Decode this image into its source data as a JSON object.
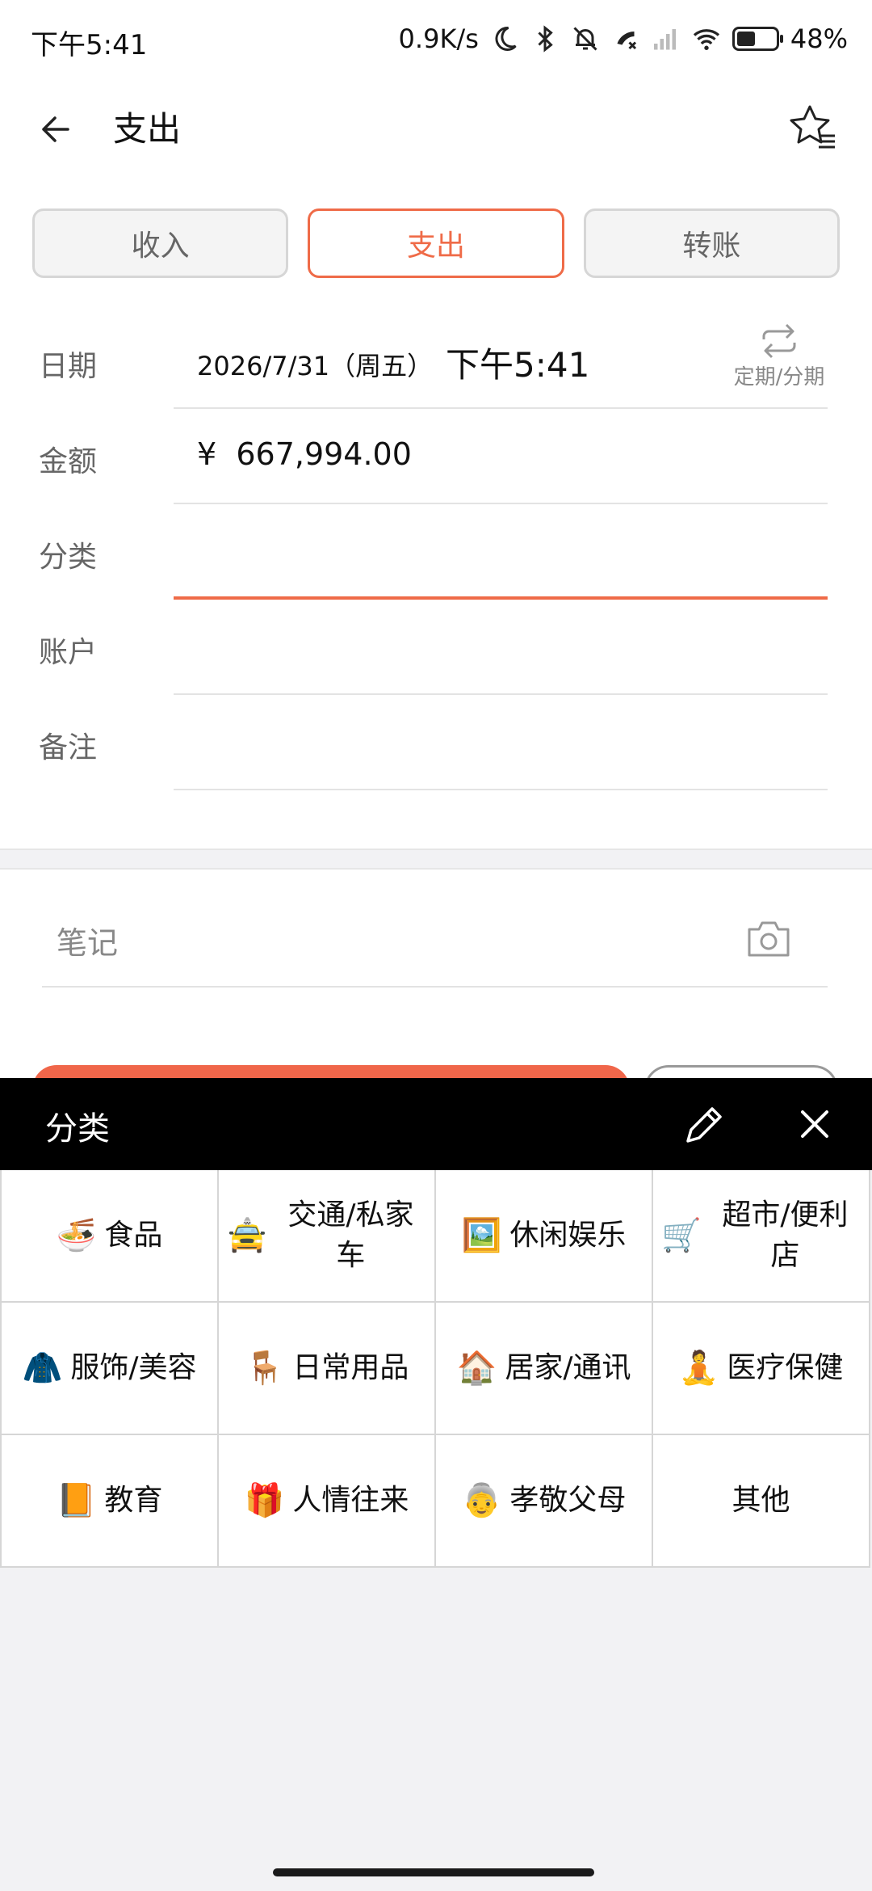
{
  "status_bar": {
    "time": "下午5:41",
    "network_speed": "0.9K/s",
    "battery_percent": "48%",
    "battery_level": 0.48
  },
  "header": {
    "title": "支出",
    "back_icon": "arrow-left-icon",
    "favorite_icon": "star-list-icon"
  },
  "tabs": [
    {
      "label": "收入",
      "active": false
    },
    {
      "label": "支出",
      "active": true
    },
    {
      "label": "转账",
      "active": false
    }
  ],
  "form": {
    "date_label": "日期",
    "date_value": "2026/7/31（周五）",
    "time_value": "下午5:41",
    "periodic_label": "定期/分期",
    "amount_label": "金额",
    "amount_value": "¥  667,994.00",
    "category_label": "分类",
    "category_value": "",
    "account_label": "账户",
    "account_value": "",
    "remark_label": "备注",
    "remark_value": ""
  },
  "note": {
    "placeholder": "笔记",
    "camera_icon": "camera-icon"
  },
  "category_sheet": {
    "title": "分类",
    "edit_icon": "pencil-icon",
    "close_icon": "close-icon",
    "items": [
      {
        "emoji": "🍜",
        "label": "食品"
      },
      {
        "emoji": "🚖",
        "label": "交通/私家车"
      },
      {
        "emoji": "🖼️",
        "label": "休闲娱乐"
      },
      {
        "emoji": "🛒",
        "label": "超市/便利店"
      },
      {
        "emoji": "🧥",
        "label": "服饰/美容"
      },
      {
        "emoji": "🪑",
        "label": "日常用品"
      },
      {
        "emoji": "🏠",
        "label": "居家/通讯"
      },
      {
        "emoji": "🧘",
        "label": "医疗保健"
      },
      {
        "emoji": "📙",
        "label": "教育"
      },
      {
        "emoji": "🎁",
        "label": "人情往来"
      },
      {
        "emoji": "👵",
        "label": "孝敬父母"
      },
      {
        "emoji": "",
        "label": "其他"
      }
    ]
  },
  "colors": {
    "accent": "#ef6b48",
    "sheet_header": "#000000"
  }
}
